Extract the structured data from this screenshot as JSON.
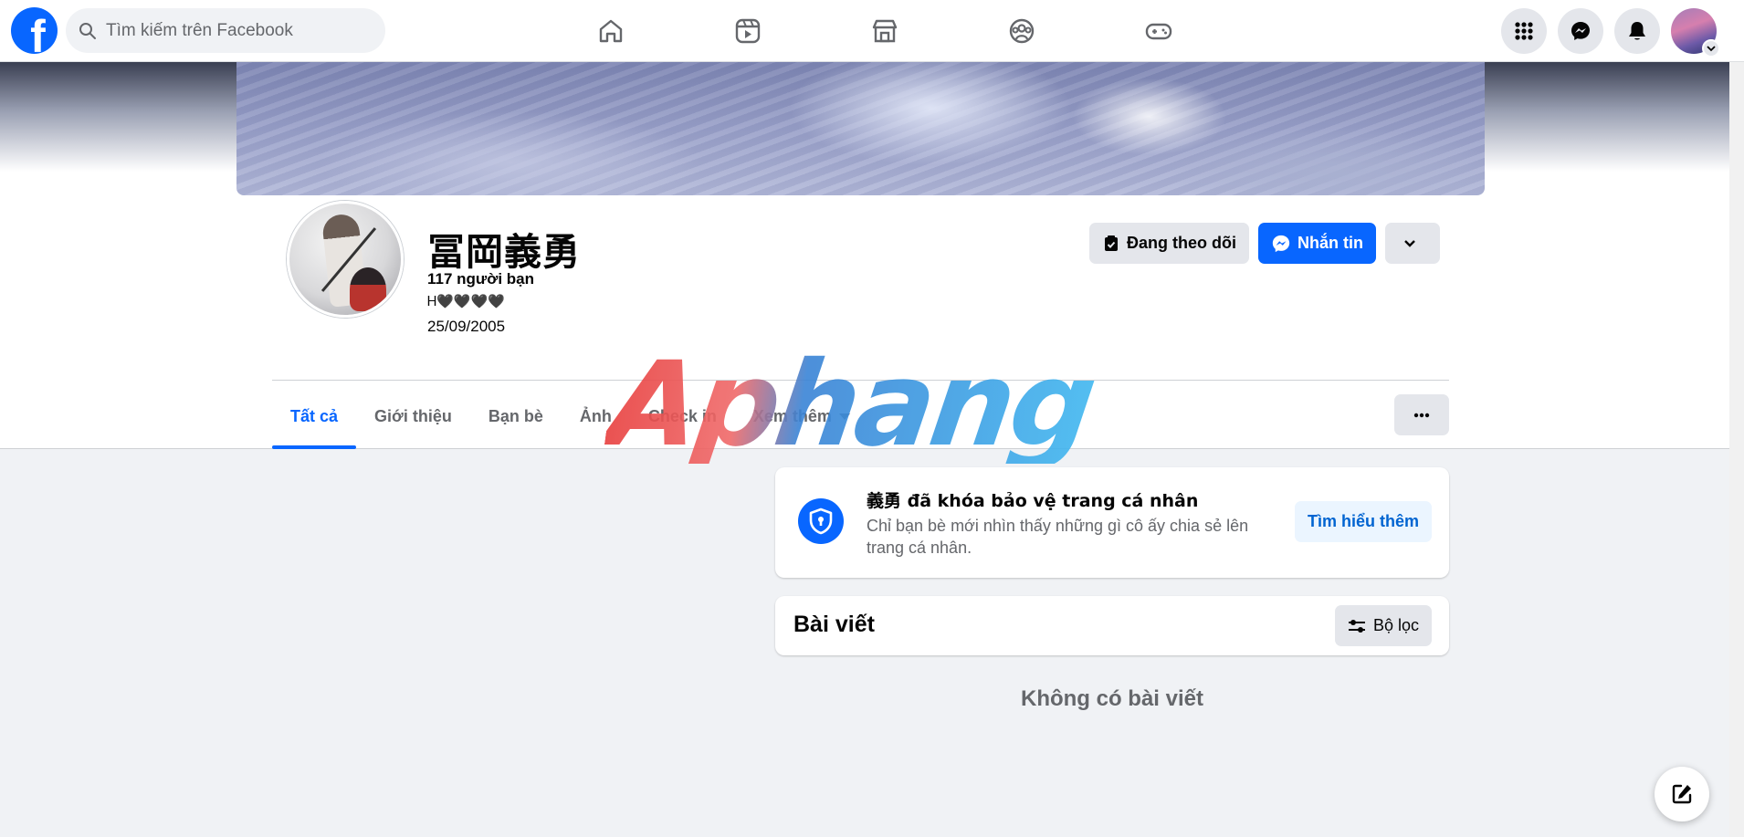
{
  "topnav": {
    "logo": "f",
    "search_placeholder": "Tìm kiếm trên Facebook",
    "center_icons": [
      "home-icon",
      "video-icon",
      "marketplace-icon",
      "groups-icon",
      "gaming-icon"
    ],
    "right_icons": [
      "menu-grid-icon",
      "messenger-icon",
      "notifications-icon"
    ]
  },
  "profile": {
    "name": "冨岡義勇",
    "friends": "117 người bạn",
    "bio": "Ꮋ🖤🖤🖤🖤",
    "birthday": "25/09/2005",
    "actions": {
      "following": "Đang theo dõi",
      "message": "Nhắn tin"
    }
  },
  "tabs": [
    {
      "label": "Tất cả",
      "active": true
    },
    {
      "label": "Giới thiệu"
    },
    {
      "label": "Bạn bè"
    },
    {
      "label": "Ảnh"
    },
    {
      "label": "Check in"
    },
    {
      "label": "Xem thêm"
    }
  ],
  "lock_card": {
    "title": "義勇 đã khóa bảo vệ trang cá nhân",
    "description": "Chỉ bạn bè mới nhìn thấy những gì cô ấy chia sẻ lên trang cá nhân.",
    "learn_more": "Tìm hiểu thêm"
  },
  "posts": {
    "title": "Bài viết",
    "filter": "Bộ lọc",
    "empty": "Không có bài viết"
  },
  "watermark": "Aphang",
  "colors": {
    "brand_blue": "#0866ff",
    "page_bg": "#f0f2f5",
    "secondary_text": "#65676b"
  }
}
